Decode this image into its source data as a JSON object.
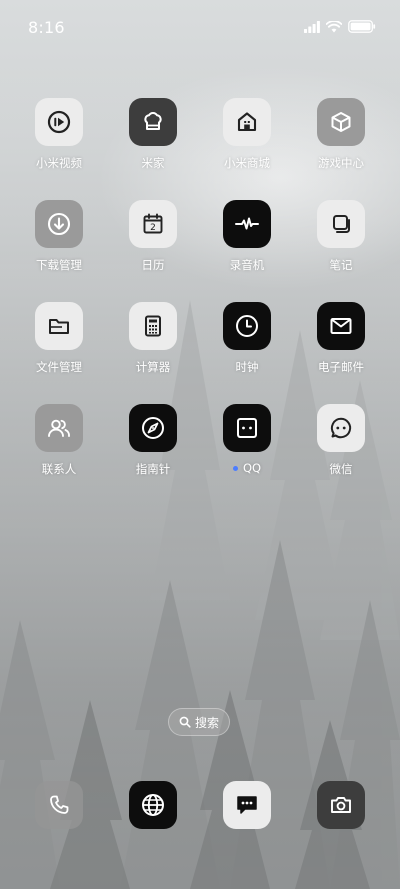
{
  "status_bar": {
    "time": "8:16",
    "icons": [
      "signal-icon",
      "wifi-icon",
      "battery-icon"
    ]
  },
  "apps": [
    {
      "label": "小米视频",
      "icon": "play-circle-icon"
    },
    {
      "label": "米家",
      "icon": "chef-hat-icon"
    },
    {
      "label": "小米商城",
      "icon": "store-house-icon"
    },
    {
      "label": "游戏中心",
      "icon": "cube-icon"
    },
    {
      "label": "下载管理",
      "icon": "download-icon"
    },
    {
      "label": "日历",
      "icon": "calendar-icon",
      "calendar_day": "2"
    },
    {
      "label": "录音机",
      "icon": "waveform-icon"
    },
    {
      "label": "笔记",
      "icon": "notes-icon"
    },
    {
      "label": "文件管理",
      "icon": "folder-icon"
    },
    {
      "label": "计算器",
      "icon": "calculator-icon"
    },
    {
      "label": "时钟",
      "icon": "clock-icon"
    },
    {
      "label": "电子邮件",
      "icon": "mail-icon"
    },
    {
      "label": "联系人",
      "icon": "contacts-icon"
    },
    {
      "label": "指南针",
      "icon": "compass-icon"
    },
    {
      "label": "QQ",
      "icon": "qq-icon",
      "new_badge": true
    },
    {
      "label": "微信",
      "icon": "wechat-icon"
    }
  ],
  "search": {
    "label": "搜索",
    "icon": "search-icon"
  },
  "dock": [
    {
      "icon": "phone-icon"
    },
    {
      "icon": "browser-globe-icon"
    },
    {
      "icon": "messages-icon"
    },
    {
      "icon": "camera-icon"
    }
  ],
  "colors": {
    "new_badge": "#4c7dff"
  }
}
